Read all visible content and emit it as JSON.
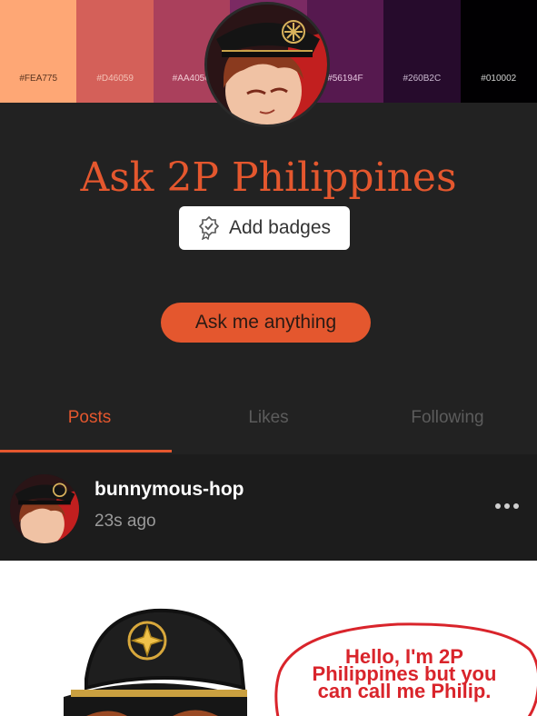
{
  "palette": [
    {
      "hex": "#FEA775",
      "label": "#FEA775",
      "label_color": "#5a3520"
    },
    {
      "hex": "#D46059",
      "label": "#D46059",
      "label_color": "#f3c2b6"
    },
    {
      "hex": "#AA405C",
      "label": "#AA405C",
      "label_color": "#f0c8d0"
    },
    {
      "hex": "#7B2A63",
      "label": "",
      "label_color": "#e8c8e0"
    },
    {
      "hex": "#56194F",
      "label": "#56194F",
      "label_color": "#e4c4de"
    },
    {
      "hex": "#260B2C",
      "label": "#260B2C",
      "label_color": "#c9b8cf"
    },
    {
      "hex": "#010002",
      "label": "#010002",
      "label_color": "#cfcfcf"
    }
  ],
  "blog": {
    "title": "Ask 2P Philippines",
    "badges_label": "Add badges",
    "ask_label": "Ask me anything",
    "accent": "#e4572e"
  },
  "tabs": [
    {
      "label": "Posts",
      "active": true
    },
    {
      "label": "Likes",
      "active": false
    },
    {
      "label": "Following",
      "active": false
    }
  ],
  "post": {
    "username": "bunnymous-hop",
    "time": "23s ago",
    "more_icon": "more-dots-icon",
    "speech_lines": [
      "Hello, I'm 2P",
      "Philippines but you",
      "can call me Philip."
    ]
  }
}
